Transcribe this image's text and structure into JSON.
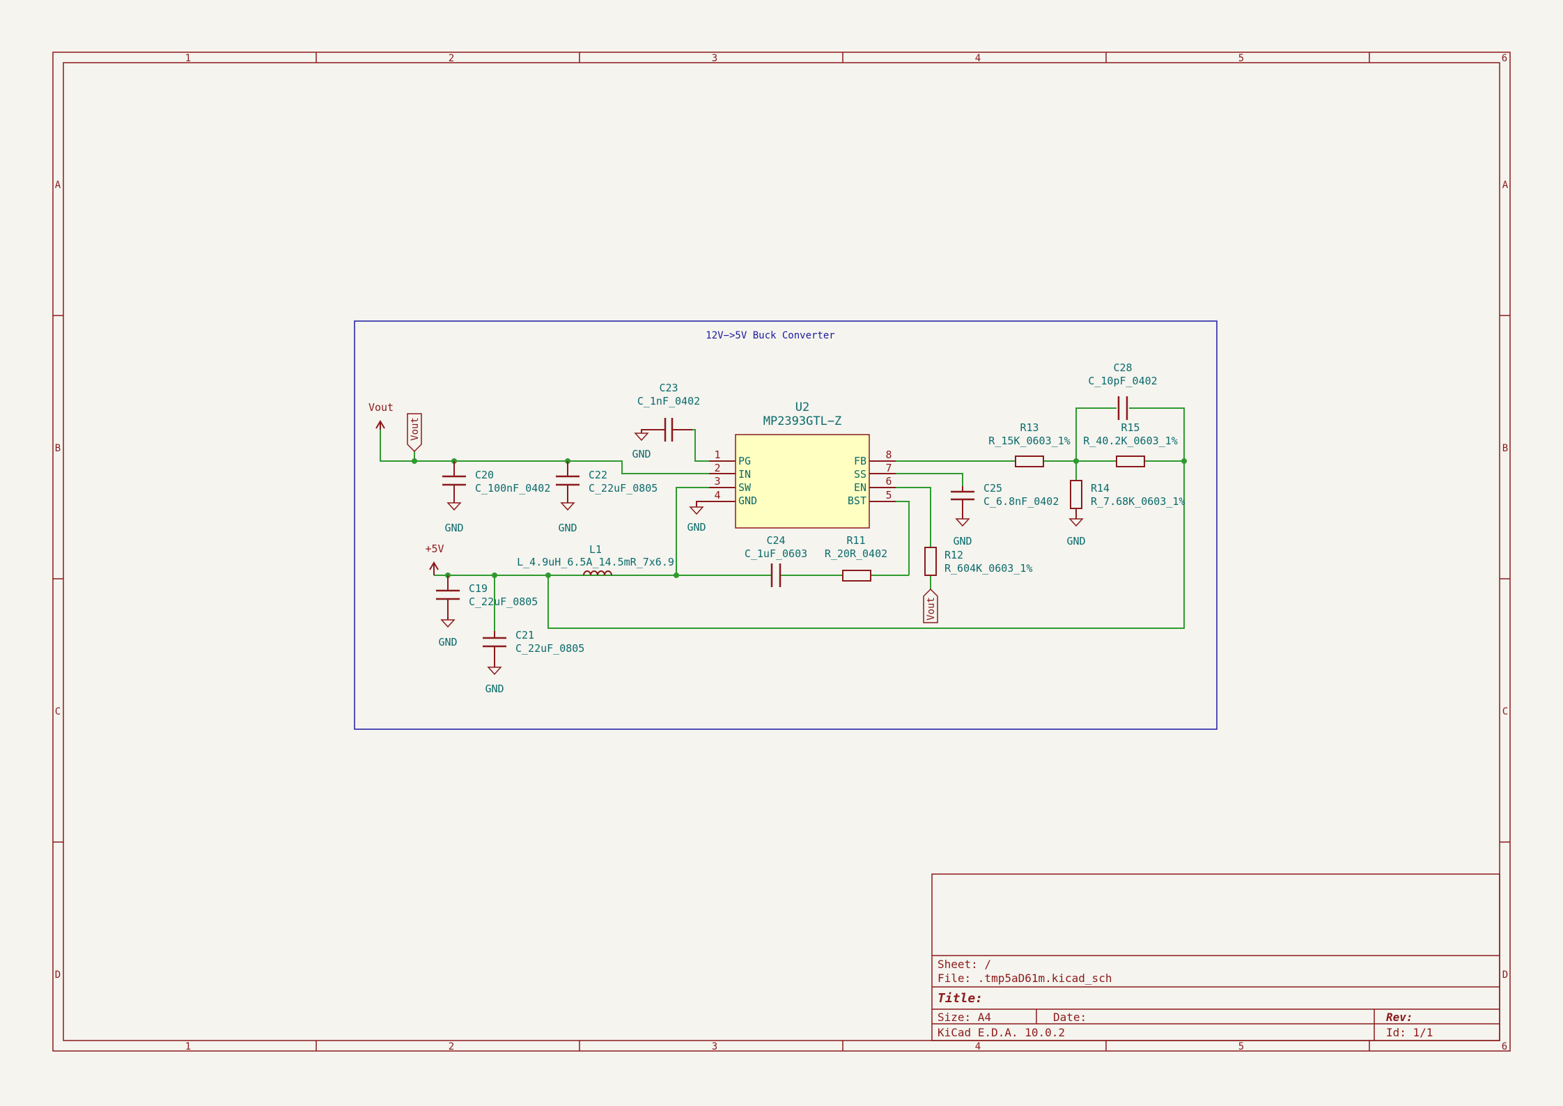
{
  "sheet": {
    "columns": [
      "1",
      "2",
      "3",
      "4",
      "5",
      "6"
    ],
    "rows": [
      "A",
      "B",
      "C",
      "D"
    ]
  },
  "block_title": "12V−>5V Buck Converter",
  "colors": {
    "frame": "#8b1a1a",
    "wire": "#2f9a2f",
    "text": "#0b6b6b",
    "box": "#1a1aa0",
    "ic_fill": "#ffffc2"
  },
  "ic": {
    "ref": "U2",
    "value": "MP2393GTL−Z",
    "left_pins": [
      {
        "num": "1",
        "name": "PG"
      },
      {
        "num": "2",
        "name": "IN"
      },
      {
        "num": "3",
        "name": "SW"
      },
      {
        "num": "4",
        "name": "GND"
      }
    ],
    "right_pins": [
      {
        "num": "8",
        "name": "FB"
      },
      {
        "num": "7",
        "name": "SS"
      },
      {
        "num": "6",
        "name": "EN"
      },
      {
        "num": "5",
        "name": "BST"
      }
    ]
  },
  "components": {
    "C23": {
      "ref": "C23",
      "value": "C_1nF_0402"
    },
    "C20": {
      "ref": "C20",
      "value": "C_100nF_0402"
    },
    "C22": {
      "ref": "C22",
      "value": "C_22uF_0805"
    },
    "C19": {
      "ref": "C19",
      "value": "C_22uF_0805"
    },
    "C21": {
      "ref": "C21",
      "value": "C_22uF_0805"
    },
    "L1": {
      "ref": "L1",
      "value": "L_4.9uH_6.5A_14.5mR_7x6.9"
    },
    "C24": {
      "ref": "C24",
      "value": "C_1uF_0603"
    },
    "R11": {
      "ref": "R11",
      "value": "R_20R_0402"
    },
    "R12": {
      "ref": "R12",
      "value": "R_604K_0603_1%"
    },
    "C25": {
      "ref": "C25",
      "value": "C_6.8nF_0402"
    },
    "R13": {
      "ref": "R13",
      "value": "R_15K_0603_1%"
    },
    "R15": {
      "ref": "R15",
      "value": "R_40.2K_0603_1%"
    },
    "R14": {
      "ref": "R14",
      "value": "R_7.68K_0603_1%"
    },
    "C28": {
      "ref": "C28",
      "value": "C_10pF_0402"
    }
  },
  "power": {
    "gnd": "GND",
    "vout": "Vout",
    "plus5": "+5V"
  },
  "global_labels": {
    "vout_label": "Vout"
  },
  "title_block": {
    "sheet": "Sheet: /",
    "file": "File: .tmp5aD61m.kicad_sch",
    "title": "Title:",
    "size": "Size: A4",
    "date": "Date:",
    "rev": "Rev:",
    "tool": "KiCad E.D.A. 10.0.2",
    "id": "Id: 1/1"
  }
}
